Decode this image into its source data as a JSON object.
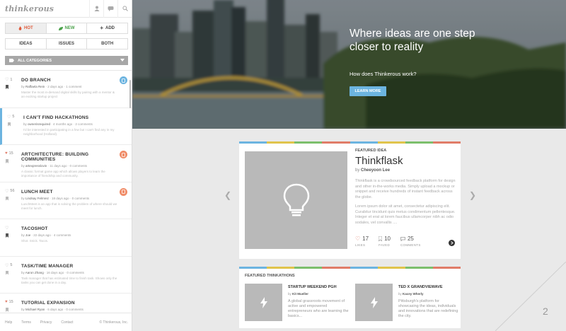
{
  "brand": {
    "logo": "thinkerous"
  },
  "sidebar": {
    "sort_tabs": [
      {
        "label": "HOT",
        "icon": "flame-icon",
        "selected": true
      },
      {
        "label": "NEW",
        "icon": "leaf-icon",
        "selected": false
      },
      {
        "label": "ADD",
        "icon": "plus-icon",
        "selected": false
      }
    ],
    "type_tabs": [
      {
        "label": "IDEAS",
        "selected": false
      },
      {
        "label": "ISSUES",
        "selected": false
      },
      {
        "label": "BOTH",
        "selected": true
      }
    ],
    "category_filter": "ALL CATEGORIES",
    "feed": [
      {
        "likes": "1",
        "liked": false,
        "title": "DO BRANCH",
        "author": "Raffaela Rein",
        "time": "2 days ago",
        "comments": "1 comment",
        "desc": "Master the most in-demand digital skills by pairing with a mentor & an exciting startup project",
        "badge": "blue",
        "bookmarked": true
      },
      {
        "likes": "5",
        "liked": false,
        "title": "I CAN'T FIND HACKATHONS",
        "author": "ownerisrequired",
        "time": "4 months ago",
        "comments": "2 comments",
        "desc": "I'd be interested in participating in a few but I can't find any in my neighborhood (Holland).",
        "badge": "",
        "bookmarked": false,
        "highlight": true
      },
      {
        "likes": "15",
        "liked": true,
        "title": "ARTCHITECTURE: BUILDING COMMUNITIES",
        "author": "artexpresslovin",
        "time": "11 days ago",
        "comments": "0 comments",
        "desc": "A classic format game app which allows players to learn the importance of friendship and community.",
        "badge": "orange",
        "bookmarked": false
      },
      {
        "likes": "56",
        "liked": false,
        "title": "LUNCH MEET",
        "author": "Lindsay Felmrez",
        "time": "18 days ago",
        "comments": "0 comments",
        "desc": "LunchMeet is an app that is solving the problem of where should we meet for lunch.",
        "badge": "orange",
        "bookmarked": false
      },
      {
        "likes": "",
        "liked": false,
        "title": "TACOSHOT",
        "author": "Joe",
        "time": "22 days ago",
        "comments": "4 comments",
        "desc": "Shot. Snick. Tacos.",
        "badge": "",
        "bookmarked": true
      },
      {
        "likes": "5",
        "liked": false,
        "title": "TASK/TIME MANAGER",
        "author": "Aaron Zhang",
        "time": "16 days ago",
        "comments": "0 comments",
        "desc": "Task manager that has estimated time to finish task. Shows only the tasks you can get done in a day.",
        "badge": "",
        "bookmarked": false
      },
      {
        "likes": "15",
        "liked": true,
        "title": "TUTORIAL EXPANSION",
        "author": "Michael Ryan",
        "time": "6 days ago",
        "comments": "0 comments",
        "desc": "",
        "badge": "",
        "bookmarked": false
      }
    ],
    "footer": {
      "links": [
        "Help",
        "Terms",
        "Privacy",
        "Contact"
      ],
      "copyright": "© Thinkerous, Inc."
    }
  },
  "hero": {
    "title": "Where ideas are one step closer to reality",
    "subtitle": "How does Thinkerous work?",
    "cta": "LEARN MORE"
  },
  "featured_idea": {
    "label": "FEATURED IDEA",
    "title": "Thinkflask",
    "by_prefix": "by",
    "author": "Cheeyoon Lee",
    "desc1": "Thinkflask is a crowdsourced feedback platform for design and other in-the-works media. Simply upload a mockup or snippet and receive hundreds of instant feedback across the globe.",
    "desc2": "Lorem ipsum dolor sit amet, consectetur adipiscing elit. Curabitur tincidunt quis metus condimentum pellentesque. Integer et erat at lorem faucibus ullamcorper nibh ac odio sodales, vel convallis ....",
    "likes": "17",
    "likes_label": "LIKES",
    "faved": "10",
    "faved_label": "FAVED",
    "comments": "25",
    "comments_label": "COMMENTS"
  },
  "hackathons": {
    "label": "FEATURED THINKATHONS",
    "items": [
      {
        "title": "STARTUP WEEKEND PGH",
        "author": "Kit Mueller",
        "desc": "A global grassroots movement of active and empowered entrepreneurs who are learning the basics..."
      },
      {
        "title": "TED X GRANDVIEWAVE",
        "author": "Kacey Wherly",
        "desc": "Pittsburgh's platform for showcasing the ideas, individuals and innovations that are redefining the city."
      }
    ]
  },
  "page_number": "2",
  "colors": {
    "accent_blue": "#6cb4e0",
    "hot_red": "#e05a3b",
    "new_green": "#4ca24c",
    "badge_orange": "#f08c68"
  }
}
